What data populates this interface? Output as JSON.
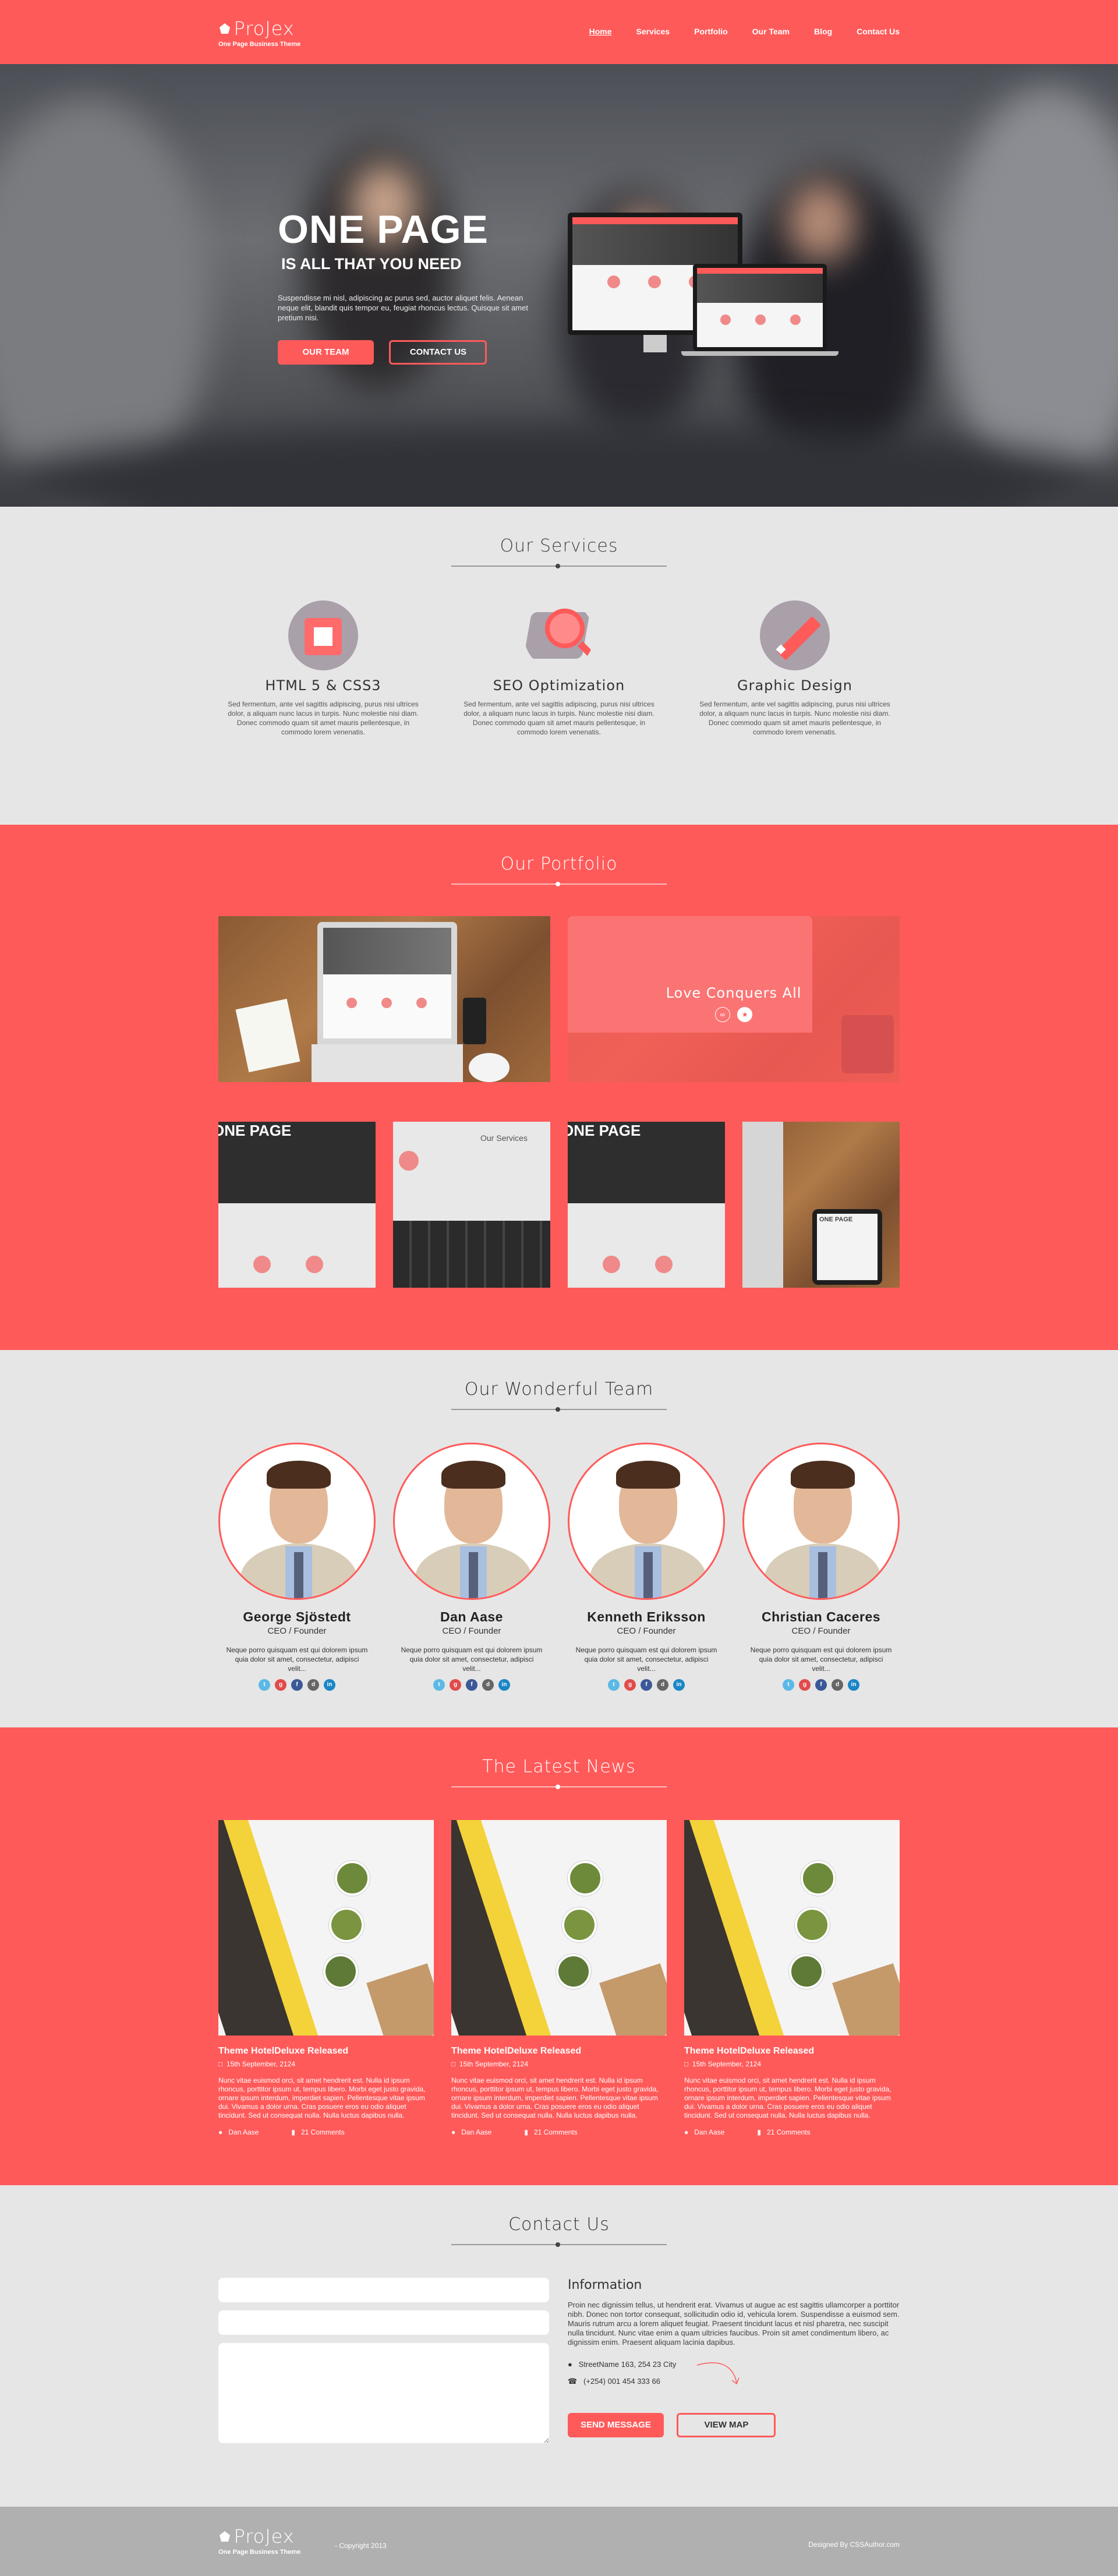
{
  "brand": {
    "name": "ProJex",
    "tagline": "One Page Business Theme"
  },
  "colors": {
    "accent": "#ff5a5a",
    "light_bg": "#e6e6e6",
    "footer_bg": "#b0b0b0"
  },
  "nav": [
    "Home",
    "Services",
    "Portfolio",
    "Our Team",
    "Blog",
    "Contact Us"
  ],
  "hero": {
    "title": "ONE PAGE",
    "subtitle": "IS ALL THAT YOU NEED",
    "text": "Suspendisse mi nisl, adipiscing ac purus sed, auctor aliquet felis. Aenean neque elit, blandit quis tempor eu, feugiat rhoncus lectus. Quisque sit amet pretium nisi.",
    "btn_team": "OUR TEAM",
    "btn_contact": "CONTACT US"
  },
  "services": {
    "title": "Our Services",
    "items": [
      {
        "name": "HTML 5 & CSS3",
        "icon": "html5-icon",
        "text": "Sed fermentum, ante vel sagittis adipiscing, purus nisi ultrices dolor, a aliquam nunc lacus in turpis. Nunc molestie nisi diam. Donec commodo quam sit amet mauris pellentesque, in commodo lorem venenatis."
      },
      {
        "name": "SEO Optimization",
        "icon": "magnifier-icon",
        "text": "Sed fermentum, ante vel sagittis adipiscing, purus nisi ultrices dolor, a aliquam nunc lacus in turpis. Nunc molestie nisi diam. Donec commodo quam sit amet mauris pellentesque, in commodo lorem venenatis."
      },
      {
        "name": "Graphic Design",
        "icon": "pencil-icon",
        "text": "Sed fermentum, ante vel sagittis adipiscing, purus nisi ultrices dolor, a aliquam nunc lacus in turpis. Nunc molestie nisi diam. Donec commodo quam sit amet mauris pellentesque, in commodo lorem venenatis."
      }
    ]
  },
  "portfolio": {
    "title": "Our Portfolio",
    "featured_caption": "Love Conquers All",
    "small_labels": [
      "ONE PAGE",
      "Our Services",
      "ONE PAGE",
      "ONE PAGE"
    ]
  },
  "team": {
    "title": "Our Wonderful Team",
    "members": [
      {
        "name": "George Sjöstedt",
        "role": "CEO / Founder",
        "bio": "Neque porro quisquam est qui dolorem ipsum quia dolor sit amet, consectetur, adipisci velit..."
      },
      {
        "name": "Dan Aase",
        "role": "CEO / Founder",
        "bio": "Neque porro quisquam est qui dolorem ipsum quia dolor sit amet, consectetur, adipisci velit..."
      },
      {
        "name": "Kenneth Eriksson",
        "role": "CEO / Founder",
        "bio": "Neque porro quisquam est qui dolorem ipsum quia dolor sit amet, consectetur, adipisci velit..."
      },
      {
        "name": "Christian Caceres",
        "role": "CEO / Founder",
        "bio": "Neque porro quisquam est qui dolorem ipsum quia dolor sit amet, consectetur, adipisci velit..."
      }
    ]
  },
  "news": {
    "title": "The Latest News",
    "posts": [
      {
        "title": "Theme HotelDeluxe Released",
        "date": "15th September, 2124",
        "text": "Nunc vitae euismod orci, sit amet hendrerit est. Nulla id ipsum rhoncus, porttitor ipsum ut, tempus libero. Morbi eget justo gravida, ornare ipsum interdum, imperdiet sapien. Pellentesque vitae ipsum dui. Vivamus a dolor urna. Cras posuere eros eu odio aliquet tincidunt. Sed ut consequat nulla. Nulla luctus dapibus nulla.",
        "author": "Dan Aase",
        "comments": "21 Comments"
      },
      {
        "title": "Theme HotelDeluxe Released",
        "date": "15th September, 2124",
        "text": "Nunc vitae euismod orci, sit amet hendrerit est. Nulla id ipsum rhoncus, porttitor ipsum ut, tempus libero. Morbi eget justo gravida, ornare ipsum interdum, imperdiet sapien. Pellentesque vitae ipsum dui. Vivamus a dolor urna. Cras posuere eros eu odio aliquet tincidunt. Sed ut consequat nulla. Nulla luctus dapibus nulla.",
        "author": "Dan Aase",
        "comments": "21 Comments"
      },
      {
        "title": "Theme HotelDeluxe Released",
        "date": "15th September, 2124",
        "text": "Nunc vitae euismod orci, sit amet hendrerit est. Nulla id ipsum rhoncus, porttitor ipsum ut, tempus libero. Morbi eget justo gravida, ornare ipsum interdum, imperdiet sapien. Pellentesque vitae ipsum dui. Vivamus a dolor urna. Cras posuere eros eu odio aliquet tincidunt. Sed ut consequat nulla. Nulla luctus dapibus nulla.",
        "author": "Dan Aase",
        "comments": "21 Comments"
      }
    ]
  },
  "contact": {
    "title": "Contact Us",
    "info_title": "Information",
    "info_text": "Proin nec dignissim tellus, ut hendrerit erat. Vivamus ut augue ac est sagittis ullamcorper a porttitor nibh. Donec non tortor consequat, sollicitudin odio id, vehicula lorem. Suspendisse a euismod sem. Mauris rutrum arcu a lorem aliquet feugiat. Praesent tincidunt lacus et nisl pharetra, nec suscipit nulla tincidunt. Nunc vitae enim a quam ultricies faucibus. Proin sit amet condimentum libero, ac dignissim enim. Praesent aliquam lacinia dapibus.",
    "address": "StreetName 163, 254 23 City",
    "phone": "(+254) 001 454 333 66",
    "btn_send": "SEND MESSAGE",
    "btn_map": "VIEW MAP"
  },
  "footer": {
    "copyright": "- Copyright 2013",
    "designed_by": "Designed By CSSAuthor.com"
  }
}
